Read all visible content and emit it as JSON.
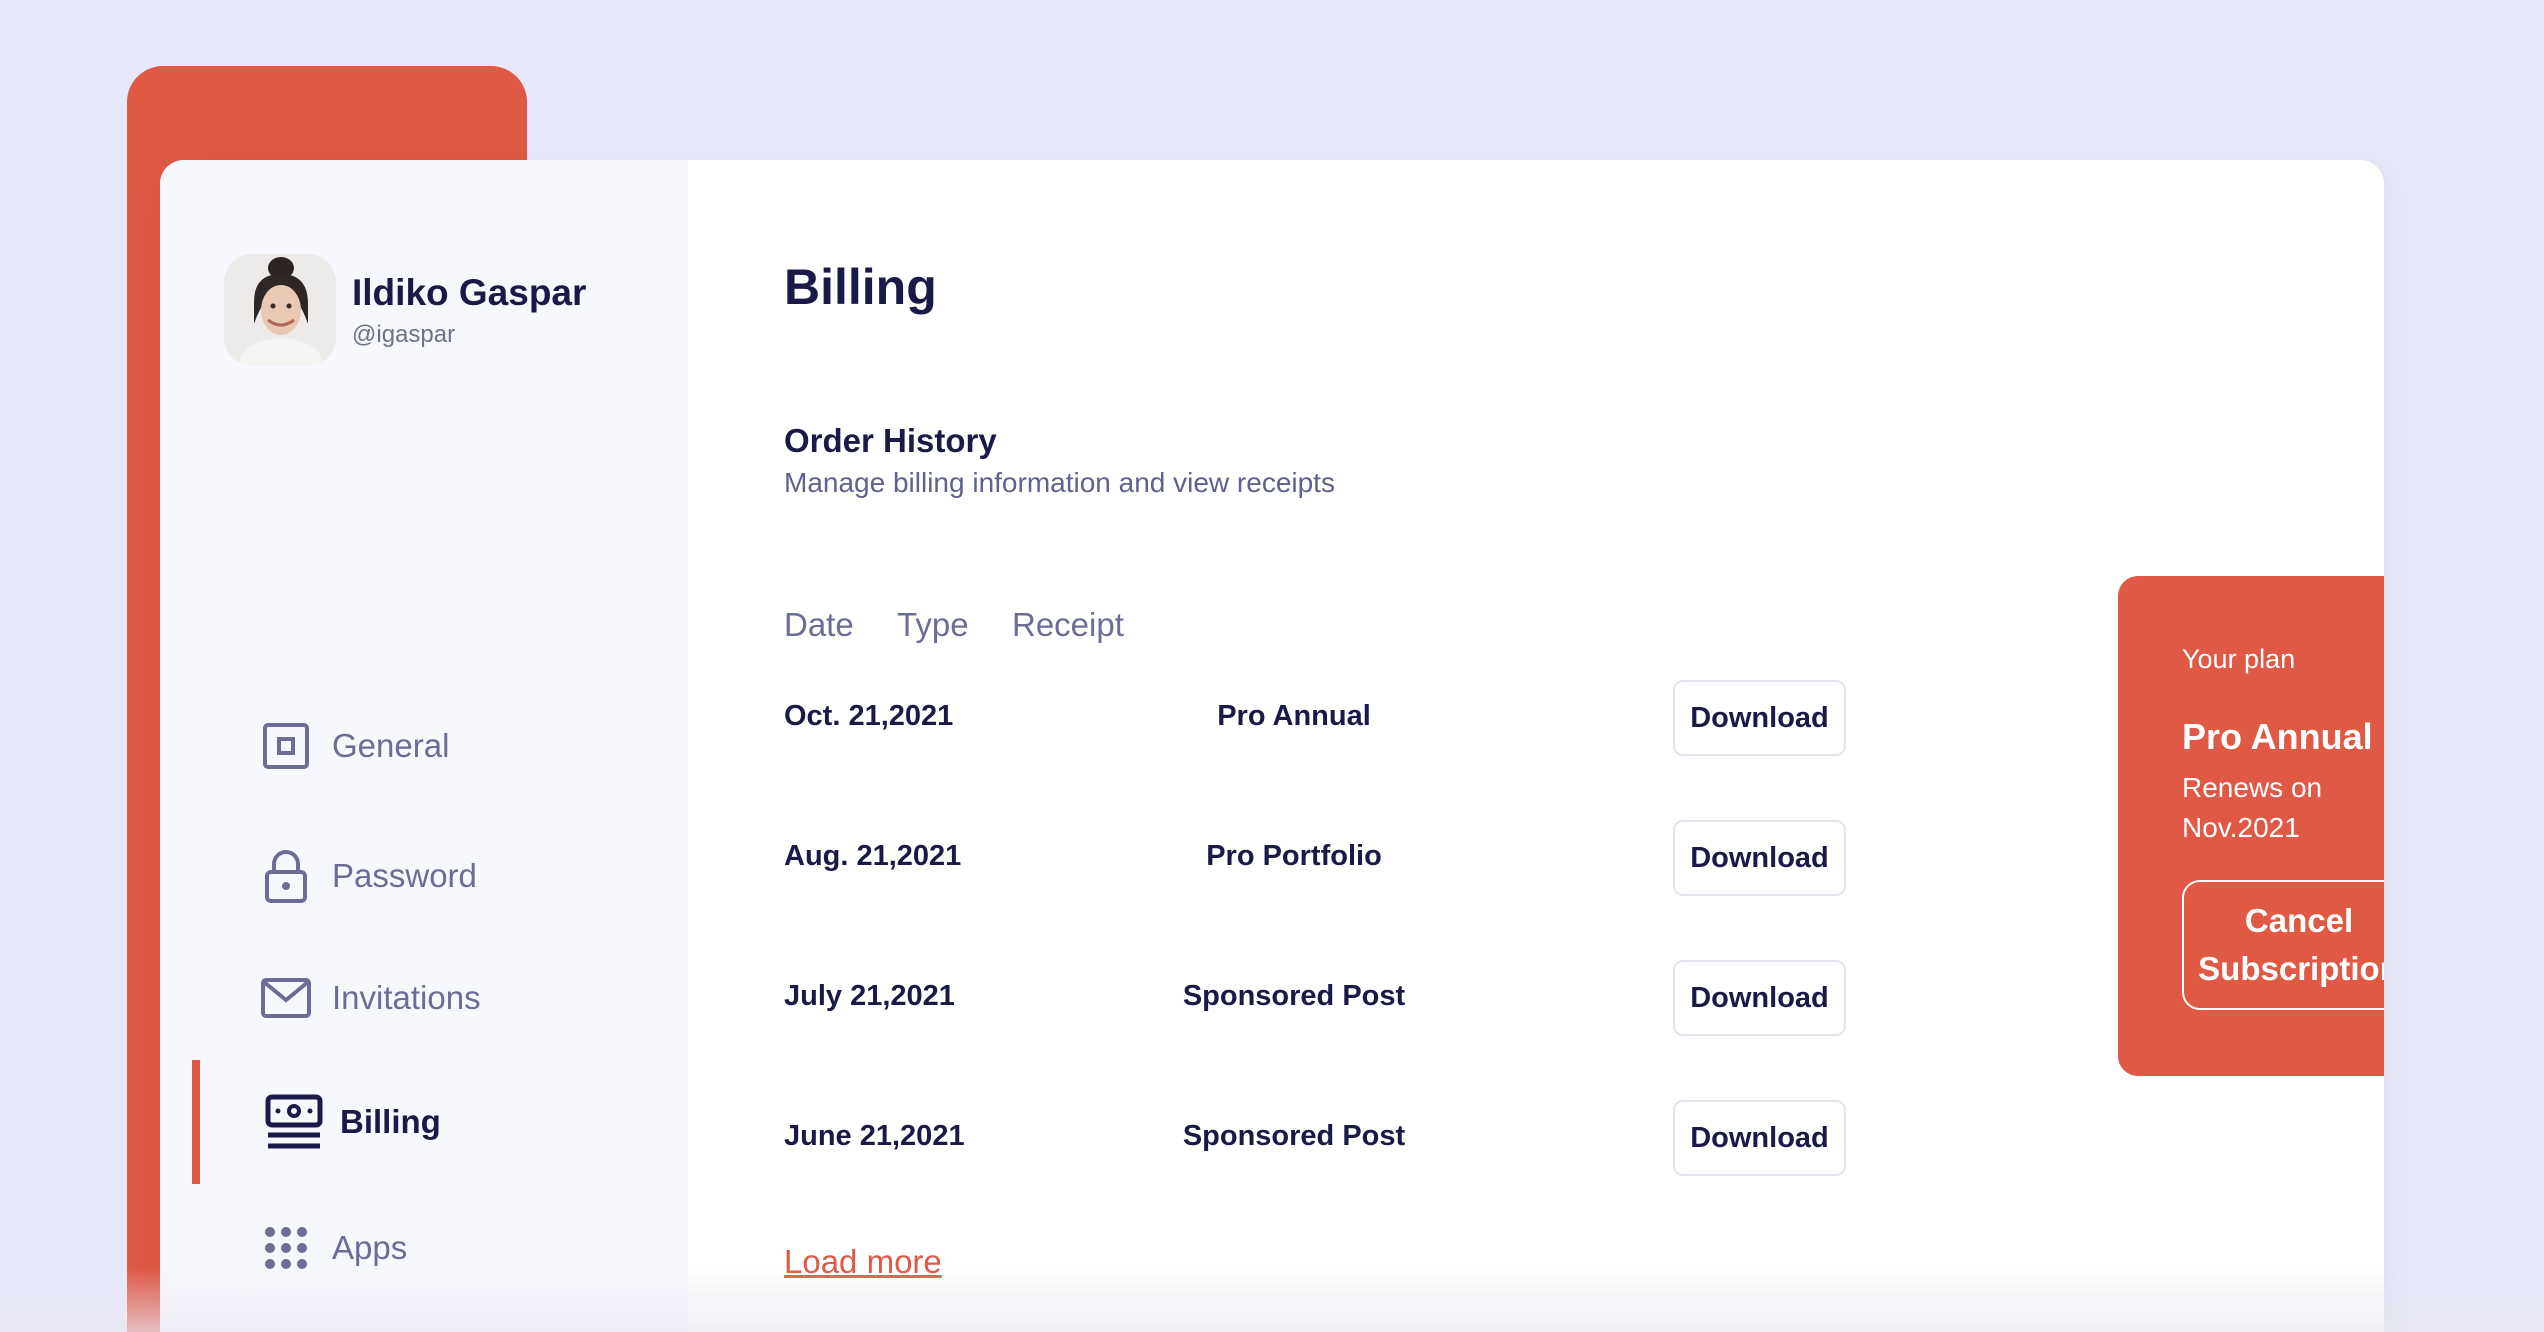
{
  "profile": {
    "name": "Ildiko Gaspar",
    "handle": "@igaspar"
  },
  "nav": {
    "items": [
      {
        "label": "General",
        "icon": "square-icon"
      },
      {
        "label": "Password",
        "icon": "lock-icon"
      },
      {
        "label": "Invitations",
        "icon": "mail-icon"
      },
      {
        "label": "Billing",
        "icon": "money-icon",
        "active": true
      },
      {
        "label": "Apps",
        "icon": "grid-icon"
      }
    ]
  },
  "page": {
    "title": "Billing"
  },
  "orders": {
    "title": "Order History",
    "subtitle": "Manage billing information and view receipts",
    "columns": [
      "Date",
      "Type",
      "Receipt"
    ],
    "rows": [
      {
        "date": "Oct. 21,2021",
        "type": "Pro Annual",
        "action": "Download"
      },
      {
        "date": "Aug. 21,2021",
        "type": "Pro Portfolio",
        "action": "Download"
      },
      {
        "date": "July 21,2021",
        "type": "Sponsored Post",
        "action": "Download"
      },
      {
        "date": "June 21,2021",
        "type": "Sponsored Post",
        "action": "Download"
      }
    ],
    "load_more": "Load more"
  },
  "plan": {
    "label": "Your plan",
    "name": "Pro Annual",
    "renews": "Renews on Nov.2021",
    "cancel_label": "Cancel Subscription"
  },
  "colors": {
    "accent": "#df5944",
    "background": "#e7e8f9",
    "sidebar": "#f7f8fd",
    "text_dark": "#191a47",
    "text_muted": "#6b6d96"
  }
}
